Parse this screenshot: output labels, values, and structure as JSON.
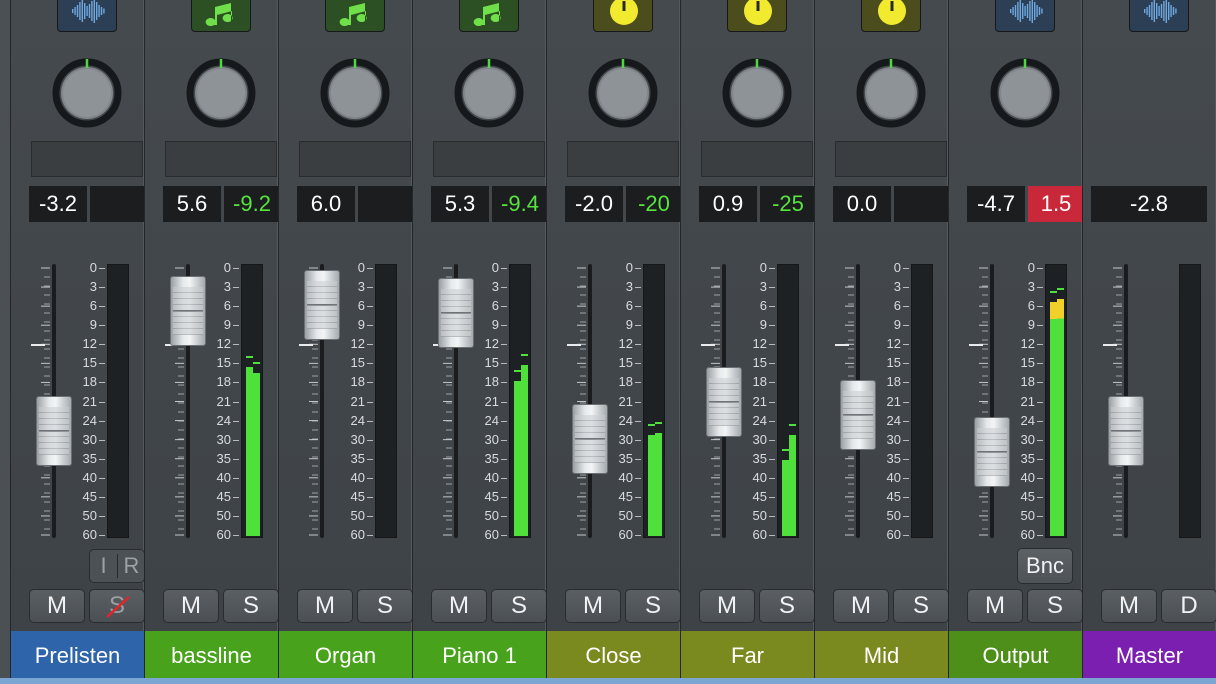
{
  "scale_labels": [
    "0",
    "3",
    "6",
    "9",
    "12",
    "15",
    "18",
    "21",
    "24",
    "30",
    "35",
    "40",
    "45",
    "50",
    "60"
  ],
  "strips": [
    {
      "name": "Prelisten",
      "icon": "waveform-icon",
      "icon_bg": "#2d3f55",
      "name_bg": "#2e64a9",
      "vol": "-3.2",
      "peak": "",
      "mute": "M",
      "solo": "S",
      "solo_disabled": true,
      "input_label": "I",
      "record_label": "R",
      "fader_level": 0.39,
      "meters": []
    },
    {
      "name": "bassline",
      "icon": "music-note-icon",
      "icon_bg": "#2d4f24",
      "name_bg": "#48a21c",
      "vol": "5.6",
      "peak": "-9.2",
      "peak_style": "green",
      "mute": "M",
      "solo": "S",
      "fader_level": 0.84,
      "meters": [
        0.62,
        0.6
      ]
    },
    {
      "name": "Organ",
      "icon": "music-note-icon",
      "icon_bg": "#2d4f24",
      "name_bg": "#48a21c",
      "vol": "6.0",
      "peak": "",
      "mute": "M",
      "solo": "S",
      "fader_level": 0.86,
      "meters": []
    },
    {
      "name": "Piano 1",
      "icon": "music-note-icon",
      "icon_bg": "#2d4f24",
      "name_bg": "#48a21c",
      "vol": "5.3",
      "peak": "-9.4",
      "peak_style": "green",
      "mute": "M",
      "solo": "S",
      "fader_level": 0.83,
      "meters": [
        0.57,
        0.63
      ]
    },
    {
      "name": "Close",
      "icon": "aux-icon",
      "icon_bg": "#4b4d1c",
      "name_bg": "#7a8a1e",
      "vol": "-2.0",
      "peak": "-20",
      "peak_style": "green",
      "mute": "M",
      "solo": "S",
      "fader_level": 0.36,
      "meters": [
        0.37,
        0.38
      ]
    },
    {
      "name": "Far",
      "icon": "aux-icon",
      "icon_bg": "#4b4d1c",
      "name_bg": "#7a8a1e",
      "vol": "0.9",
      "peak": "-25",
      "peak_style": "green",
      "mute": "M",
      "solo": "S",
      "fader_level": 0.5,
      "meters": [
        0.28,
        0.37
      ]
    },
    {
      "name": "Mid",
      "icon": "aux-icon",
      "icon_bg": "#4b4d1c",
      "name_bg": "#7a8a1e",
      "vol": "0.0",
      "peak": "",
      "mute": "M",
      "solo": "S",
      "fader_level": 0.45,
      "meters": []
    },
    {
      "name": "Output",
      "icon": "waveform-icon",
      "icon_bg": "#2d3f55",
      "name_bg": "#4e8f1a",
      "vol": "-4.7",
      "peak": "1.5",
      "peak_style": "red",
      "mute": "M",
      "solo": "S",
      "bounce_label": "Bnc",
      "fader_level": 0.31,
      "meters": [
        0.86,
        0.87
      ]
    },
    {
      "name": "Master",
      "icon": "waveform-icon",
      "icon_bg": "#2d3f55",
      "name_bg": "#7a1fb0",
      "vol": "-2.8",
      "mute": "M",
      "solo": "D",
      "fader_level": 0.39,
      "meters": [],
      "single_display": true
    }
  ]
}
